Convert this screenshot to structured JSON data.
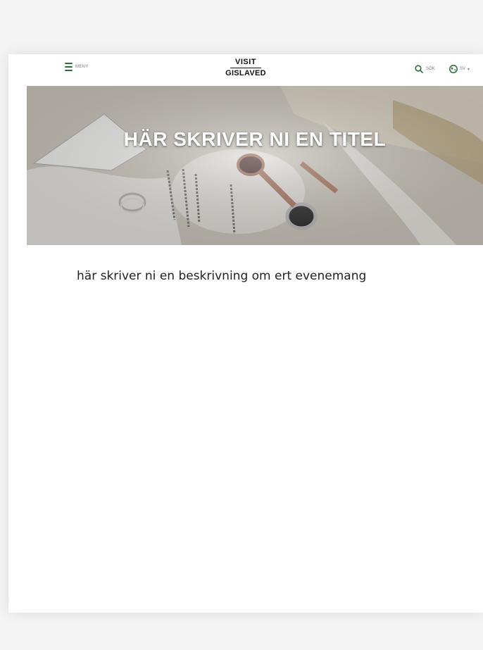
{
  "header": {
    "menu_label": "MENY",
    "logo_line1": "VISIT",
    "logo_line2": "GISLAVED",
    "search_label": "SÖK",
    "language_label": "SV",
    "brand_color": "#2f6b3a",
    "icons": [
      "menu-icon",
      "search-icon",
      "globe-icon",
      "chevron-down-icon"
    ]
  },
  "hero": {
    "title": "HÄR SKRIVER NI EN TITEL"
  },
  "main": {
    "description": "här skriver ni en beskrivning om ert evenemang"
  }
}
